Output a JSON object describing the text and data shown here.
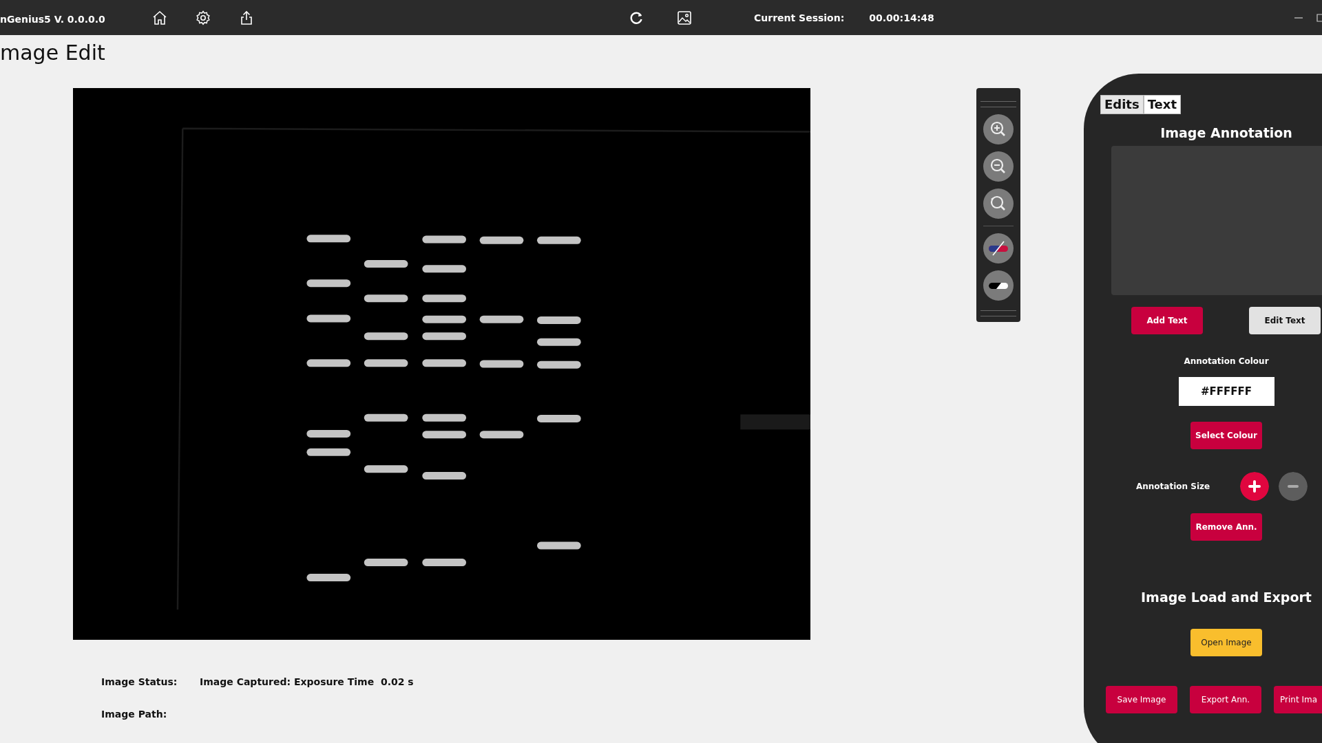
{
  "title_bar": {
    "app_title": "nGenius5 V. 0.0.0.0",
    "session_label": "Current Session:",
    "session_time": "00.00:14:48"
  },
  "page_title": "mage Edit",
  "image_status": {
    "label": "Image Status:",
    "value": "Image Captured: Exposure Time  0.02 s"
  },
  "image_path": {
    "label": "Image Path:"
  },
  "panel": {
    "tabs": [
      {
        "label": "Edits",
        "selected": false
      },
      {
        "label": "Text",
        "selected": true
      }
    ],
    "annotation": {
      "heading": "Image Annotation",
      "add_button": "Add Text",
      "edit_button": "Edit Text",
      "colour_label": "Annotation Colour",
      "colour_value": "#FFFFFF",
      "select_colour_button": "Select Colour",
      "size_label": "Annotation Size",
      "remove_button": "Remove Ann."
    },
    "load_export": {
      "heading": "Image Load and Export",
      "open_button": "Open Image",
      "buttons": [
        "Save Image",
        "Export Ann.",
        "Print Ima"
      ]
    }
  }
}
